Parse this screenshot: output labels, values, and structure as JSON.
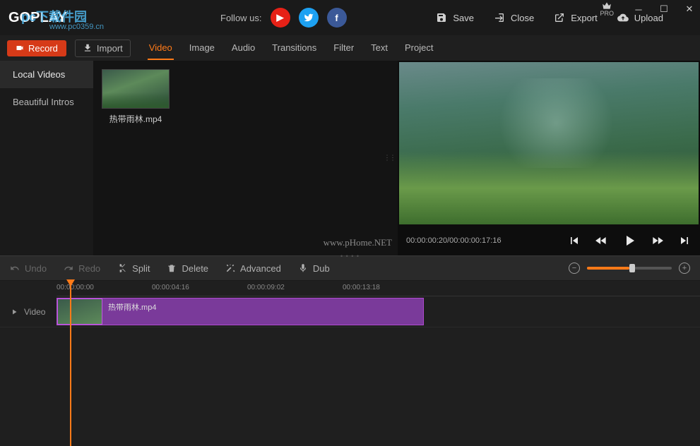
{
  "titlebar": {
    "app_name": "GOPLAY",
    "overlay_text": "pc下载件园",
    "overlay_url": "www.pc0359.cn",
    "follow_label": "Follow us:",
    "pro_label": "PRO",
    "actions": {
      "save": "Save",
      "close": "Close",
      "export": "Export",
      "upload": "Upload"
    }
  },
  "toolbar": {
    "record": "Record",
    "import": "Import",
    "tabs": [
      "Video",
      "Image",
      "Audio",
      "Transitions",
      "Filter",
      "Text",
      "Project"
    ]
  },
  "sidebar": {
    "items": [
      "Local Videos",
      "Beautiful Intros"
    ]
  },
  "library": {
    "clip_name": "热带雨林.mp4",
    "watermark": "www.pHome.NET"
  },
  "preview": {
    "time": "00:00:00:20/00:00:00:17:16"
  },
  "edit": {
    "undo": "Undo",
    "redo": "Redo",
    "split": "Split",
    "delete": "Delete",
    "advanced": "Advanced",
    "dub": "Dub"
  },
  "timeline": {
    "marks": [
      "00:00:00:00",
      "00:00:04:16",
      "00:00:09:02",
      "00:00:13:18"
    ],
    "track_label": "Video",
    "clip_label": "热带雨林.mp4"
  }
}
